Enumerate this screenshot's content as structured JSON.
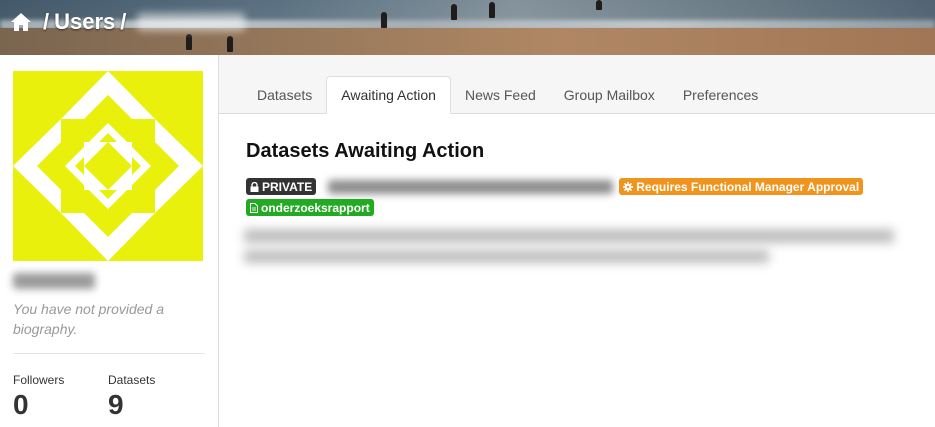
{
  "header": {
    "home_icon": "home-icon",
    "separator": "/",
    "crumb_users": "Users",
    "crumb_user_blurred": true
  },
  "sidebar": {
    "avatar_color": "#e8f00c",
    "username_blurred": true,
    "bio": "You have not provided a biography.",
    "stats": [
      {
        "label": "Followers",
        "value": "0"
      },
      {
        "label": "Datasets",
        "value": "9"
      }
    ]
  },
  "tabs": [
    {
      "label": "Datasets",
      "active": false
    },
    {
      "label": "Awaiting Action",
      "active": true
    },
    {
      "label": "News Feed",
      "active": false
    },
    {
      "label": "Group Mailbox",
      "active": false
    },
    {
      "label": "Preferences",
      "active": false
    }
  ],
  "main": {
    "title": "Datasets Awaiting Action",
    "dataset": {
      "private_label": "PRIVATE",
      "private_icon": "lock-icon",
      "title_blurred": true,
      "status_label": "Requires Functional Manager Approval",
      "status_icon": "gear-icon",
      "status_color": "#f0941e",
      "tag_label": "onderzoeksrapport",
      "tag_icon": "file-icon",
      "tag_color": "#22aa22",
      "description_blurred": true
    }
  }
}
